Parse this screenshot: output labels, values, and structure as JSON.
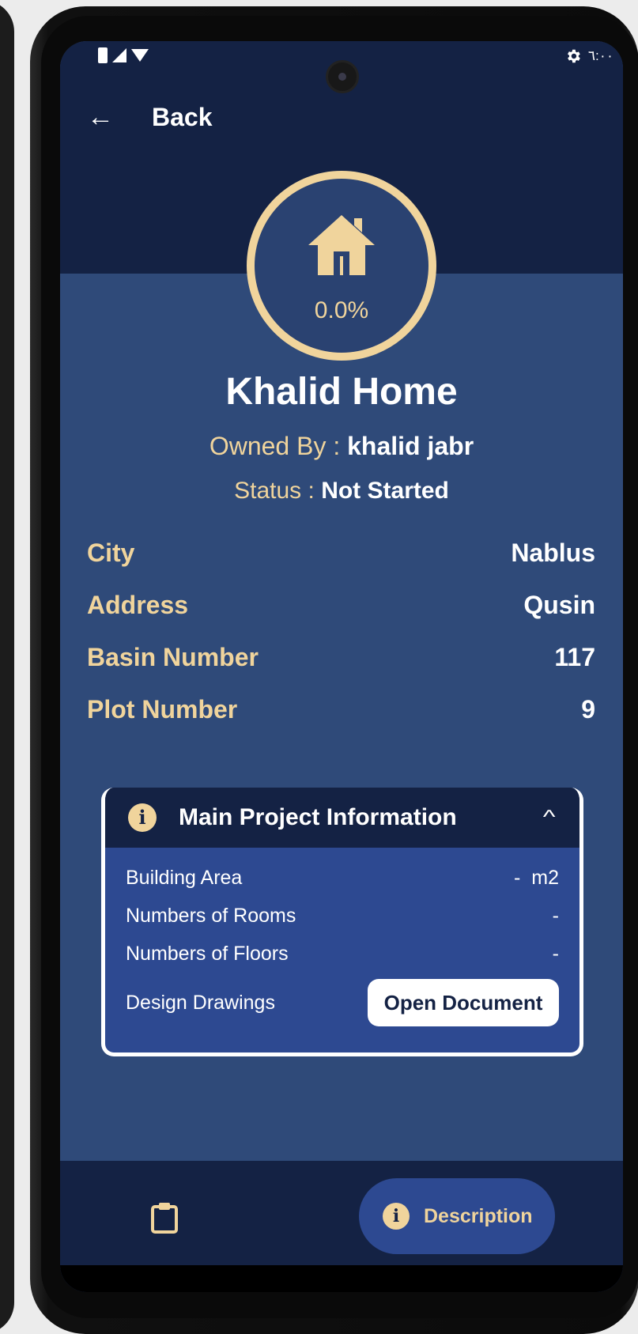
{
  "status_bar": {
    "time": "٦:٠٠",
    "icons": [
      "battery-icon",
      "signal-icon",
      "wifi-icon",
      "gear-icon"
    ]
  },
  "nav": {
    "back_label": "Back"
  },
  "progress": {
    "value_text": "0.0%",
    "fraction": 0.0,
    "icon": "home-icon"
  },
  "project": {
    "title": "Khalid Home",
    "owned_by_label": "Owned By : ",
    "owner": "khalid jabr",
    "status_label": "Status : ",
    "status": "Not Started"
  },
  "details": [
    {
      "label": "City",
      "value": "Nablus"
    },
    {
      "label": "Address",
      "value": "Qusin"
    },
    {
      "label": "Basin Number",
      "value": "117"
    },
    {
      "label": "Plot Number",
      "value": "9"
    }
  ],
  "main_info": {
    "title": "Main Project Information",
    "rows": [
      {
        "label": "Building Area",
        "value": "-  m2"
      },
      {
        "label": "Numbers of Rooms",
        "value": "-"
      },
      {
        "label": "Numbers of Floors",
        "value": "-"
      }
    ],
    "drawings_label": "Design Drawings",
    "open_document_label": "Open Document"
  },
  "bottom_nav": {
    "description_label": "Description"
  },
  "colors": {
    "accent": "#f0d49c",
    "dark_navy": "#142244",
    "mid_blue": "#2f4a79",
    "card_blue": "#2d4991"
  }
}
